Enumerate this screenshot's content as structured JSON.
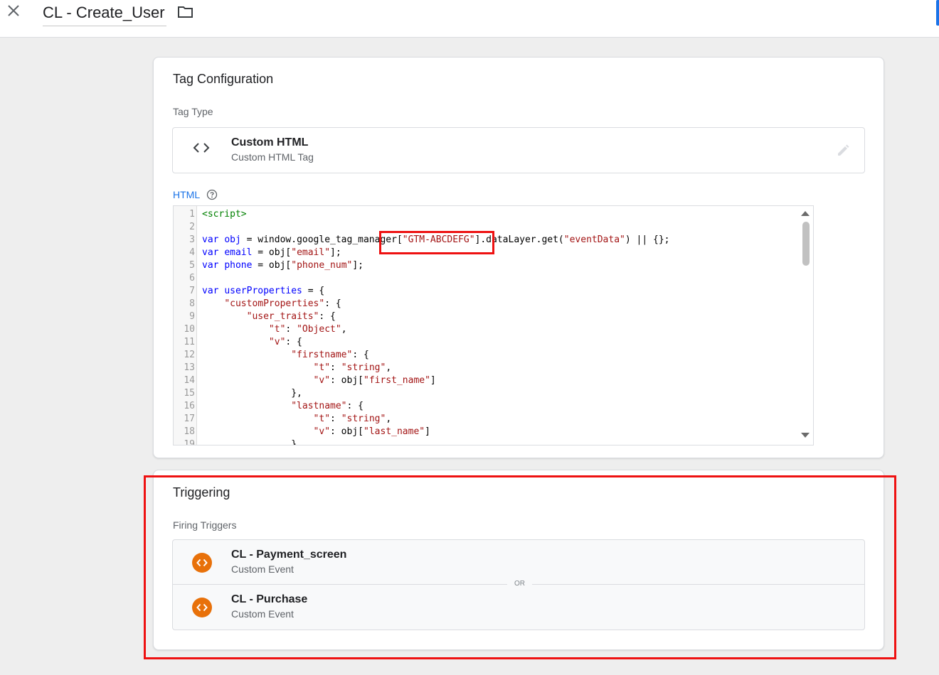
{
  "header": {
    "title": "CL - Create_User",
    "close_icon": "close-icon",
    "folder_icon": "folder-icon"
  },
  "tag_configuration": {
    "title": "Tag Configuration",
    "tag_type_label": "Tag Type",
    "tag_type": {
      "name": "Custom HTML",
      "description": "Custom HTML Tag",
      "icon": "code-brackets-icon",
      "edit_icon": "pencil-icon"
    },
    "html_label": "HTML",
    "help_icon": "help-circle-icon"
  },
  "code_lines": [
    {
      "n": "1",
      "t": [
        {
          "c": "tag",
          "s": "<script>"
        }
      ]
    },
    {
      "n": "2",
      "t": []
    },
    {
      "n": "3",
      "t": [
        {
          "c": "kw",
          "s": "var"
        },
        {
          "c": "pl",
          "s": " "
        },
        {
          "c": "vn",
          "s": "obj"
        },
        {
          "c": "pl",
          "s": " = window.google_tag_manager["
        },
        {
          "c": "str",
          "s": "\"GTM-ABCDEFG\""
        },
        {
          "c": "pl",
          "s": "].dataLayer.get("
        },
        {
          "c": "str",
          "s": "\"eventData\""
        },
        {
          "c": "pl",
          "s": ") || {};"
        }
      ]
    },
    {
      "n": "4",
      "t": [
        {
          "c": "kw",
          "s": "var"
        },
        {
          "c": "pl",
          "s": " "
        },
        {
          "c": "vn",
          "s": "email"
        },
        {
          "c": "pl",
          "s": " = obj["
        },
        {
          "c": "str",
          "s": "\"email\""
        },
        {
          "c": "pl",
          "s": "];"
        }
      ]
    },
    {
      "n": "5",
      "t": [
        {
          "c": "kw",
          "s": "var"
        },
        {
          "c": "pl",
          "s": " "
        },
        {
          "c": "vn",
          "s": "phone"
        },
        {
          "c": "pl",
          "s": " = obj["
        },
        {
          "c": "str",
          "s": "\"phone_num\""
        },
        {
          "c": "pl",
          "s": "];"
        }
      ]
    },
    {
      "n": "6",
      "t": []
    },
    {
      "n": "7",
      "t": [
        {
          "c": "kw",
          "s": "var"
        },
        {
          "c": "pl",
          "s": " "
        },
        {
          "c": "vn",
          "s": "userProperties"
        },
        {
          "c": "pl",
          "s": " = {"
        }
      ]
    },
    {
      "n": "8",
      "t": [
        {
          "c": "pl",
          "s": "    "
        },
        {
          "c": "str",
          "s": "\"customProperties\""
        },
        {
          "c": "pl",
          "s": ": {"
        }
      ]
    },
    {
      "n": "9",
      "t": [
        {
          "c": "pl",
          "s": "        "
        },
        {
          "c": "str",
          "s": "\"user_traits\""
        },
        {
          "c": "pl",
          "s": ": {"
        }
      ]
    },
    {
      "n": "10",
      "t": [
        {
          "c": "pl",
          "s": "            "
        },
        {
          "c": "str",
          "s": "\"t\""
        },
        {
          "c": "pl",
          "s": ": "
        },
        {
          "c": "str",
          "s": "\"Object\""
        },
        {
          "c": "pl",
          "s": ","
        }
      ]
    },
    {
      "n": "11",
      "t": [
        {
          "c": "pl",
          "s": "            "
        },
        {
          "c": "str",
          "s": "\"v\""
        },
        {
          "c": "pl",
          "s": ": {"
        }
      ]
    },
    {
      "n": "12",
      "t": [
        {
          "c": "pl",
          "s": "                "
        },
        {
          "c": "str",
          "s": "\"firstname\""
        },
        {
          "c": "pl",
          "s": ": {"
        }
      ]
    },
    {
      "n": "13",
      "t": [
        {
          "c": "pl",
          "s": "                    "
        },
        {
          "c": "str",
          "s": "\"t\""
        },
        {
          "c": "pl",
          "s": ": "
        },
        {
          "c": "str",
          "s": "\"string\""
        },
        {
          "c": "pl",
          "s": ","
        }
      ]
    },
    {
      "n": "14",
      "t": [
        {
          "c": "pl",
          "s": "                    "
        },
        {
          "c": "str",
          "s": "\"v\""
        },
        {
          "c": "pl",
          "s": ": obj["
        },
        {
          "c": "str",
          "s": "\"first_name\""
        },
        {
          "c": "pl",
          "s": "]"
        }
      ]
    },
    {
      "n": "15",
      "t": [
        {
          "c": "pl",
          "s": "                },"
        }
      ]
    },
    {
      "n": "16",
      "t": [
        {
          "c": "pl",
          "s": "                "
        },
        {
          "c": "str",
          "s": "\"lastname\""
        },
        {
          "c": "pl",
          "s": ": {"
        }
      ]
    },
    {
      "n": "17",
      "t": [
        {
          "c": "pl",
          "s": "                    "
        },
        {
          "c": "str",
          "s": "\"t\""
        },
        {
          "c": "pl",
          "s": ": "
        },
        {
          "c": "str",
          "s": "\"string\""
        },
        {
          "c": "pl",
          "s": ","
        }
      ]
    },
    {
      "n": "18",
      "t": [
        {
          "c": "pl",
          "s": "                    "
        },
        {
          "c": "str",
          "s": "\"v\""
        },
        {
          "c": "pl",
          "s": ": obj["
        },
        {
          "c": "str",
          "s": "\"last_name\""
        },
        {
          "c": "pl",
          "s": "]"
        }
      ]
    },
    {
      "n": "19",
      "t": [
        {
          "c": "pl",
          "s": "                }"
        }
      ]
    }
  ],
  "triggering": {
    "title": "Triggering",
    "firing_label": "Firing Triggers",
    "or_label": "OR",
    "triggers": [
      {
        "name": "CL - Payment_screen",
        "type": "Custom Event",
        "icon": "code-brackets-icon"
      },
      {
        "name": "CL - Purchase",
        "type": "Custom Event",
        "icon": "code-brackets-icon"
      }
    ]
  },
  "colors": {
    "accent": "#1a73e8",
    "trigger_icon": "#e8710a",
    "highlight": "#ee1111"
  }
}
